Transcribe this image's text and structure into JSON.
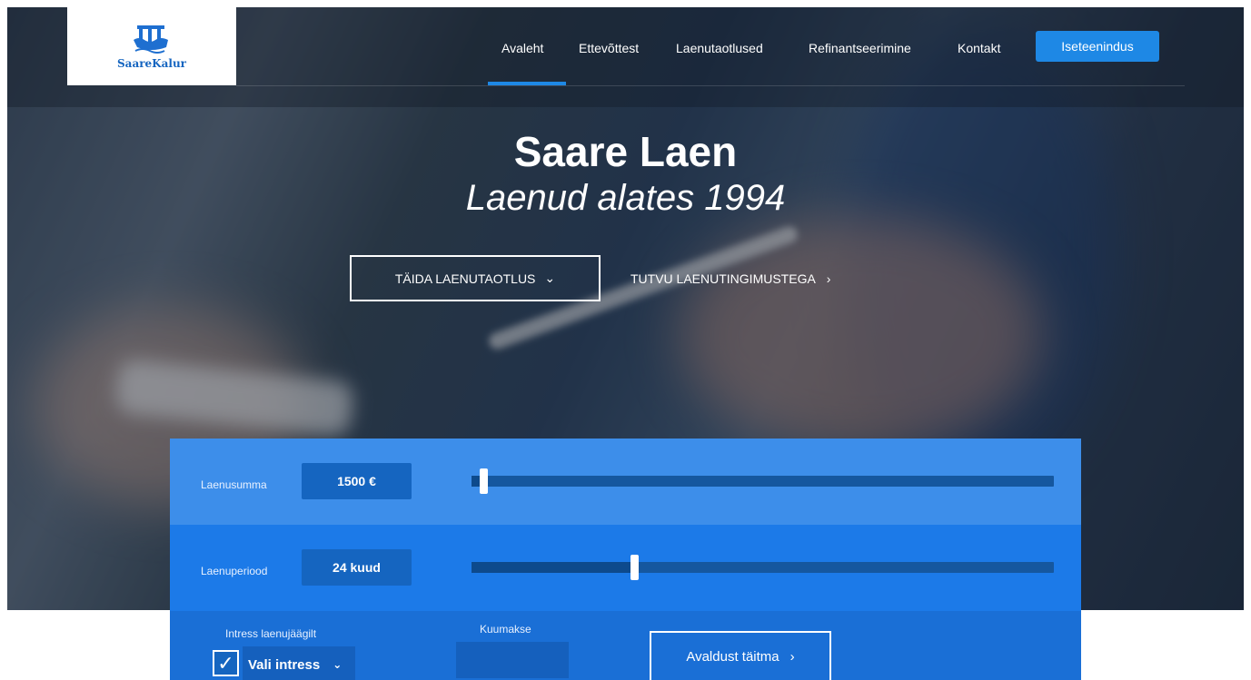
{
  "brand": {
    "logo_text": "SaareKalur",
    "logo_icon": "boat-icon"
  },
  "nav": {
    "items": [
      {
        "label": "Avaleht",
        "active": true
      },
      {
        "label": "Ettevõttest"
      },
      {
        "label": "Laenutaotlused"
      },
      {
        "label": "Refinantseerimine"
      },
      {
        "label": "Kontakt"
      }
    ],
    "cta_label": "Iseteenindus"
  },
  "hero": {
    "title": "Saare Laen",
    "subtitle": "Laenud alates 1994",
    "primary_button": "TÄIDA LAENUTAOTLUS",
    "secondary_link": "TUTVU LAENUTINGIMUSTEGA"
  },
  "calculator": {
    "amount": {
      "label": "Laenusumma",
      "value": "1500 €",
      "slider_fraction": 0.02
    },
    "period": {
      "label": "Laenuperiood",
      "value": "24 kuud",
      "slider_fraction": 0.28
    },
    "interest_label": "Intress laenujäägilt",
    "interest_checked": true,
    "interest_select": "Vali intress",
    "monthly_label": "Kuumakse",
    "monthly_value": "",
    "apply_button": "Avaldust täitma"
  },
  "colors": {
    "accent": "#1e88e5",
    "panel_light": "#3d8eea",
    "panel_mid": "#1c7ae8",
    "panel_dark": "#1a6fd6"
  }
}
